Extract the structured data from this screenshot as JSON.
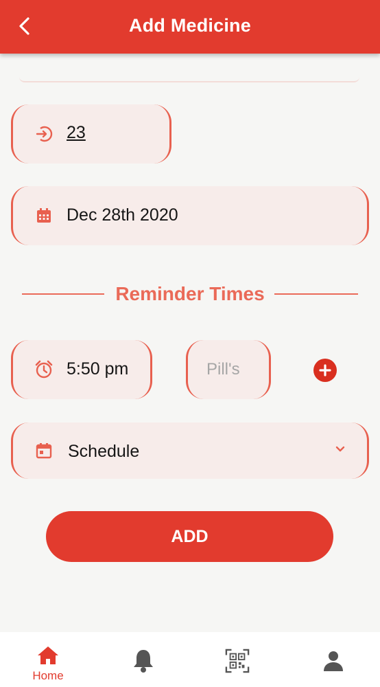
{
  "header": {
    "title": "Add Medicine",
    "back_icon": "chevron-left-icon"
  },
  "form": {
    "quantity": {
      "value": "23",
      "icon": "login-circle-icon"
    },
    "date": {
      "value": "Dec 28th 2020",
      "icon": "calendar-icon"
    },
    "reminder_section_title": "Reminder Times",
    "reminder": {
      "time": "5:50 pm",
      "time_icon": "alarm-clock-icon",
      "pills_placeholder": "Pill's",
      "add_icon": "plus-circle-icon"
    },
    "schedule": {
      "value": "Schedule",
      "icon": "calendar-event-icon",
      "dropdown_icon": "chevron-down-icon"
    },
    "submit_label": "ADD"
  },
  "bottom_nav": {
    "items": [
      {
        "label": "Home",
        "icon": "home-icon",
        "active": true
      },
      {
        "label": "",
        "icon": "bell-icon",
        "active": false
      },
      {
        "label": "",
        "icon": "qr-scan-icon",
        "active": false
      },
      {
        "label": "",
        "icon": "profile-icon",
        "active": false
      }
    ]
  },
  "colors": {
    "primary": "#e23b2e",
    "accent": "#ea6a58",
    "field_bg": "#f7ecea",
    "page_bg": "#f6f6f4",
    "inactive_icon": "#555555"
  }
}
